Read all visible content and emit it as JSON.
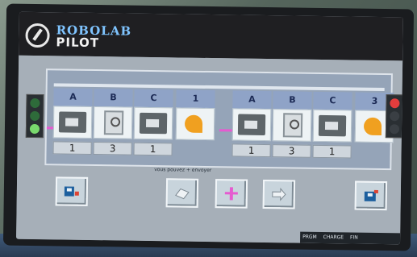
{
  "brand": {
    "line1": "ROBOLAB",
    "line2": "PILOT"
  },
  "blocks": [
    {
      "label": "A",
      "value": "1",
      "kind": "motor"
    },
    {
      "label": "B",
      "value": "3",
      "kind": "sensor"
    },
    {
      "label": "C",
      "value": "1",
      "kind": "motor"
    },
    {
      "label": "1",
      "value": "",
      "kind": "wait"
    },
    {
      "label": "A",
      "value": "1",
      "kind": "motor"
    },
    {
      "label": "B",
      "value": "3",
      "kind": "sensor"
    },
    {
      "label": "C",
      "value": "1",
      "kind": "motor"
    },
    {
      "label": "3",
      "value": "",
      "kind": "wait"
    }
  ],
  "hint": "vous pouvez + envoyer",
  "status": {
    "items": [
      "PRGM",
      "CHARGE",
      "FIN"
    ]
  },
  "colors": {
    "accent": "#7fc4ff",
    "wire": "#e55bd0",
    "highlight": "#f0a020"
  }
}
